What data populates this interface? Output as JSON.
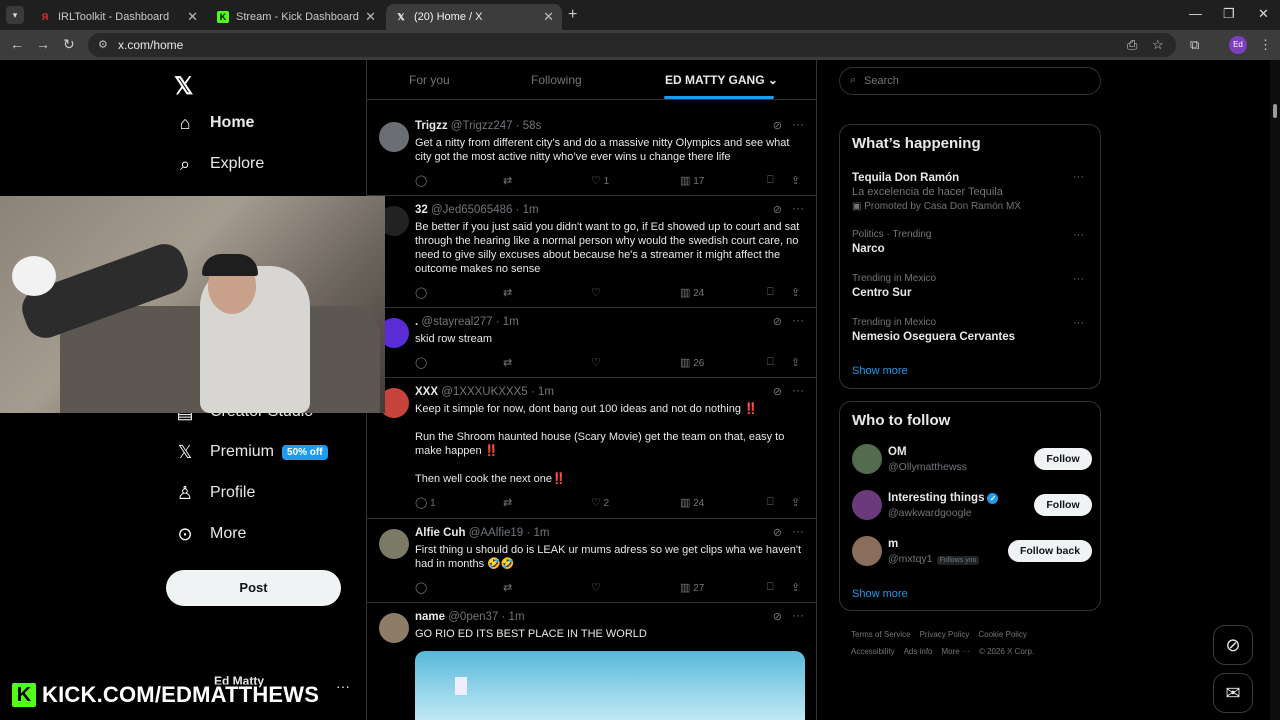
{
  "browser": {
    "tabs": [
      {
        "title": "IRLToolkit - Dashboard",
        "favicon": "irltoolkit-icon",
        "color": "#e0302e",
        "glyph": "Я"
      },
      {
        "title": "Stream - Kick Dashboard",
        "favicon": "kick-icon",
        "color": "#53fc18",
        "glyph": "K"
      },
      {
        "title": "(20) Home / X",
        "favicon": "x-icon",
        "color": "#000000",
        "glyph": "𝕏"
      }
    ],
    "url": "x.com/home",
    "profile_initials": "Ed"
  },
  "nav": {
    "items": [
      {
        "label": "Home",
        "icon": "home-icon"
      },
      {
        "label": "Explore",
        "icon": "search-icon"
      },
      {
        "label": "Premium",
        "icon": "x-icon",
        "badge": "50% off"
      },
      {
        "label": "Profile",
        "icon": "profile-icon"
      },
      {
        "label": "More",
        "icon": "more-circle-icon"
      }
    ],
    "partial_label": "Creator Studio",
    "post_label": "Post",
    "account_name": "Ed Matty"
  },
  "feed": {
    "tabs": [
      "For you",
      "Following",
      "ED MATTY GANG"
    ],
    "tweets": [
      {
        "name": "Trigzz",
        "handle": "@Trigzz247",
        "time": "58s",
        "text": "Get a nitty from different city’s and do a massive nitty Olympics and see what city got the most active nitty  who’ve ever wins u change there life",
        "replies": "",
        "reposts": "",
        "likes": "1",
        "views": "17"
      },
      {
        "name": "32",
        "handle": "@Jed65065486",
        "time": "1m",
        "text": "Be better if you just said you didn't want to go, if Ed showed up to court and sat through the hearing like a normal person why would the swedish court care, no need to give silly excuses about because he's a streamer it might affect the outcome makes no sense",
        "replies": "",
        "reposts": "",
        "likes": "",
        "views": "24"
      },
      {
        "name": ".",
        "handle": "@stayreal277",
        "time": "1m",
        "text": "skid row stream",
        "replies": "",
        "reposts": "",
        "likes": "",
        "views": "26"
      },
      {
        "name": "XXX",
        "handle": "@1XXXUKXXX5",
        "time": "1m",
        "text": "Keep it simple for now, dont bang out 100 ideas and not do nothing ‼️\n\nRun the Shroom haunted house (Scary Movie) get the team on that, easy to make happen ‼️\n\nThen well cook the next one‼️",
        "replies": "1",
        "reposts": "",
        "likes": "2",
        "views": "24"
      },
      {
        "name": "Alfie Cuh",
        "handle": "@AAlfie19",
        "time": "1m",
        "text": "First thing u should do is LEAK ur mums adress so we get clips wha we haven't had in months 🤣🤣",
        "replies": "",
        "reposts": "",
        "likes": "",
        "views": "27"
      },
      {
        "name": "name",
        "handle": "@0pen37",
        "time": "1m",
        "text": "GO RIO ED ITS BEST PLACE IN THE WORLD",
        "replies": "",
        "reposts": "",
        "likes": "",
        "views": ""
      }
    ]
  },
  "sidebar": {
    "search_placeholder": "Search",
    "whats_happening_title": "What’s happening",
    "trends": [
      {
        "meta": "",
        "title": "Tequila Don Ramón",
        "sub": "La excelencia de hacer Tequila",
        "promo": "Promoted by Casa Don Ramón MX"
      },
      {
        "meta": "Politics · Trending",
        "title": "Narco",
        "sub": "",
        "promo": ""
      },
      {
        "meta": "Trending in Mexico",
        "title": "Centro Sur",
        "sub": "",
        "promo": ""
      },
      {
        "meta": "Trending in Mexico",
        "title": "Nemesio Oseguera Cervantes",
        "sub": "",
        "promo": ""
      }
    ],
    "show_more": "Show more",
    "who_to_follow_title": "Who to follow",
    "follow": [
      {
        "name": "OM",
        "handle": "@Ollymatthewss",
        "button": "Follow",
        "verified": false,
        "follows_you": ""
      },
      {
        "name": "Interesting things",
        "handle": "@awkwardgoogle",
        "button": "Follow",
        "verified": true,
        "follows_you": ""
      },
      {
        "name": "m",
        "handle": "@mxtqy1",
        "button": "Follow back",
        "verified": false,
        "follows_you": "Follows you"
      }
    ],
    "footer": [
      "Terms of Service",
      "Privacy Policy",
      "Cookie Policy",
      "Accessibility",
      "Ads info",
      "More ···",
      "© 2026 X Corp."
    ]
  },
  "overlay": {
    "kick_banner": "KICK.COM/EDMATTHEWS",
    "kick_logo": "K"
  }
}
